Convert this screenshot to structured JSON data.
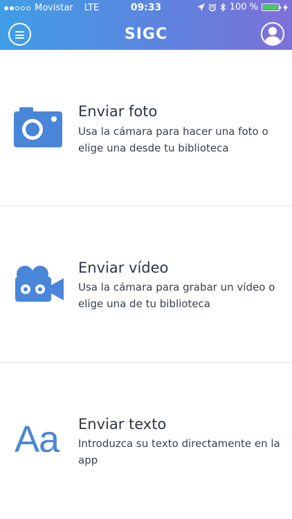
{
  "status_bar": {
    "carrier": "Movistar",
    "network": "LTE",
    "time": "09:33",
    "battery": "100 %",
    "battery_level": 1.0
  },
  "header": {
    "title": "SIGC",
    "menu_icon": "menu-icon",
    "profile_icon": "user-icon"
  },
  "options": [
    {
      "title": "Enviar foto",
      "description": "Usa la cámara para hacer una foto o elige una desde tu biblioteca",
      "icon": "camera-icon"
    },
    {
      "title": "Enviar vídeo",
      "description": "Usa la cámara para grabar un vídeo o elige una de tu biblioteca",
      "icon": "video-camera-icon"
    },
    {
      "title": "Enviar texto",
      "description": "Introduzca su texto directamente en la app",
      "icon_text": "Aa"
    }
  ],
  "colors": {
    "accent": "#4a86d8",
    "header_start": "#3f9ee6",
    "header_end": "#7e70d8",
    "battery": "#43d04f"
  }
}
